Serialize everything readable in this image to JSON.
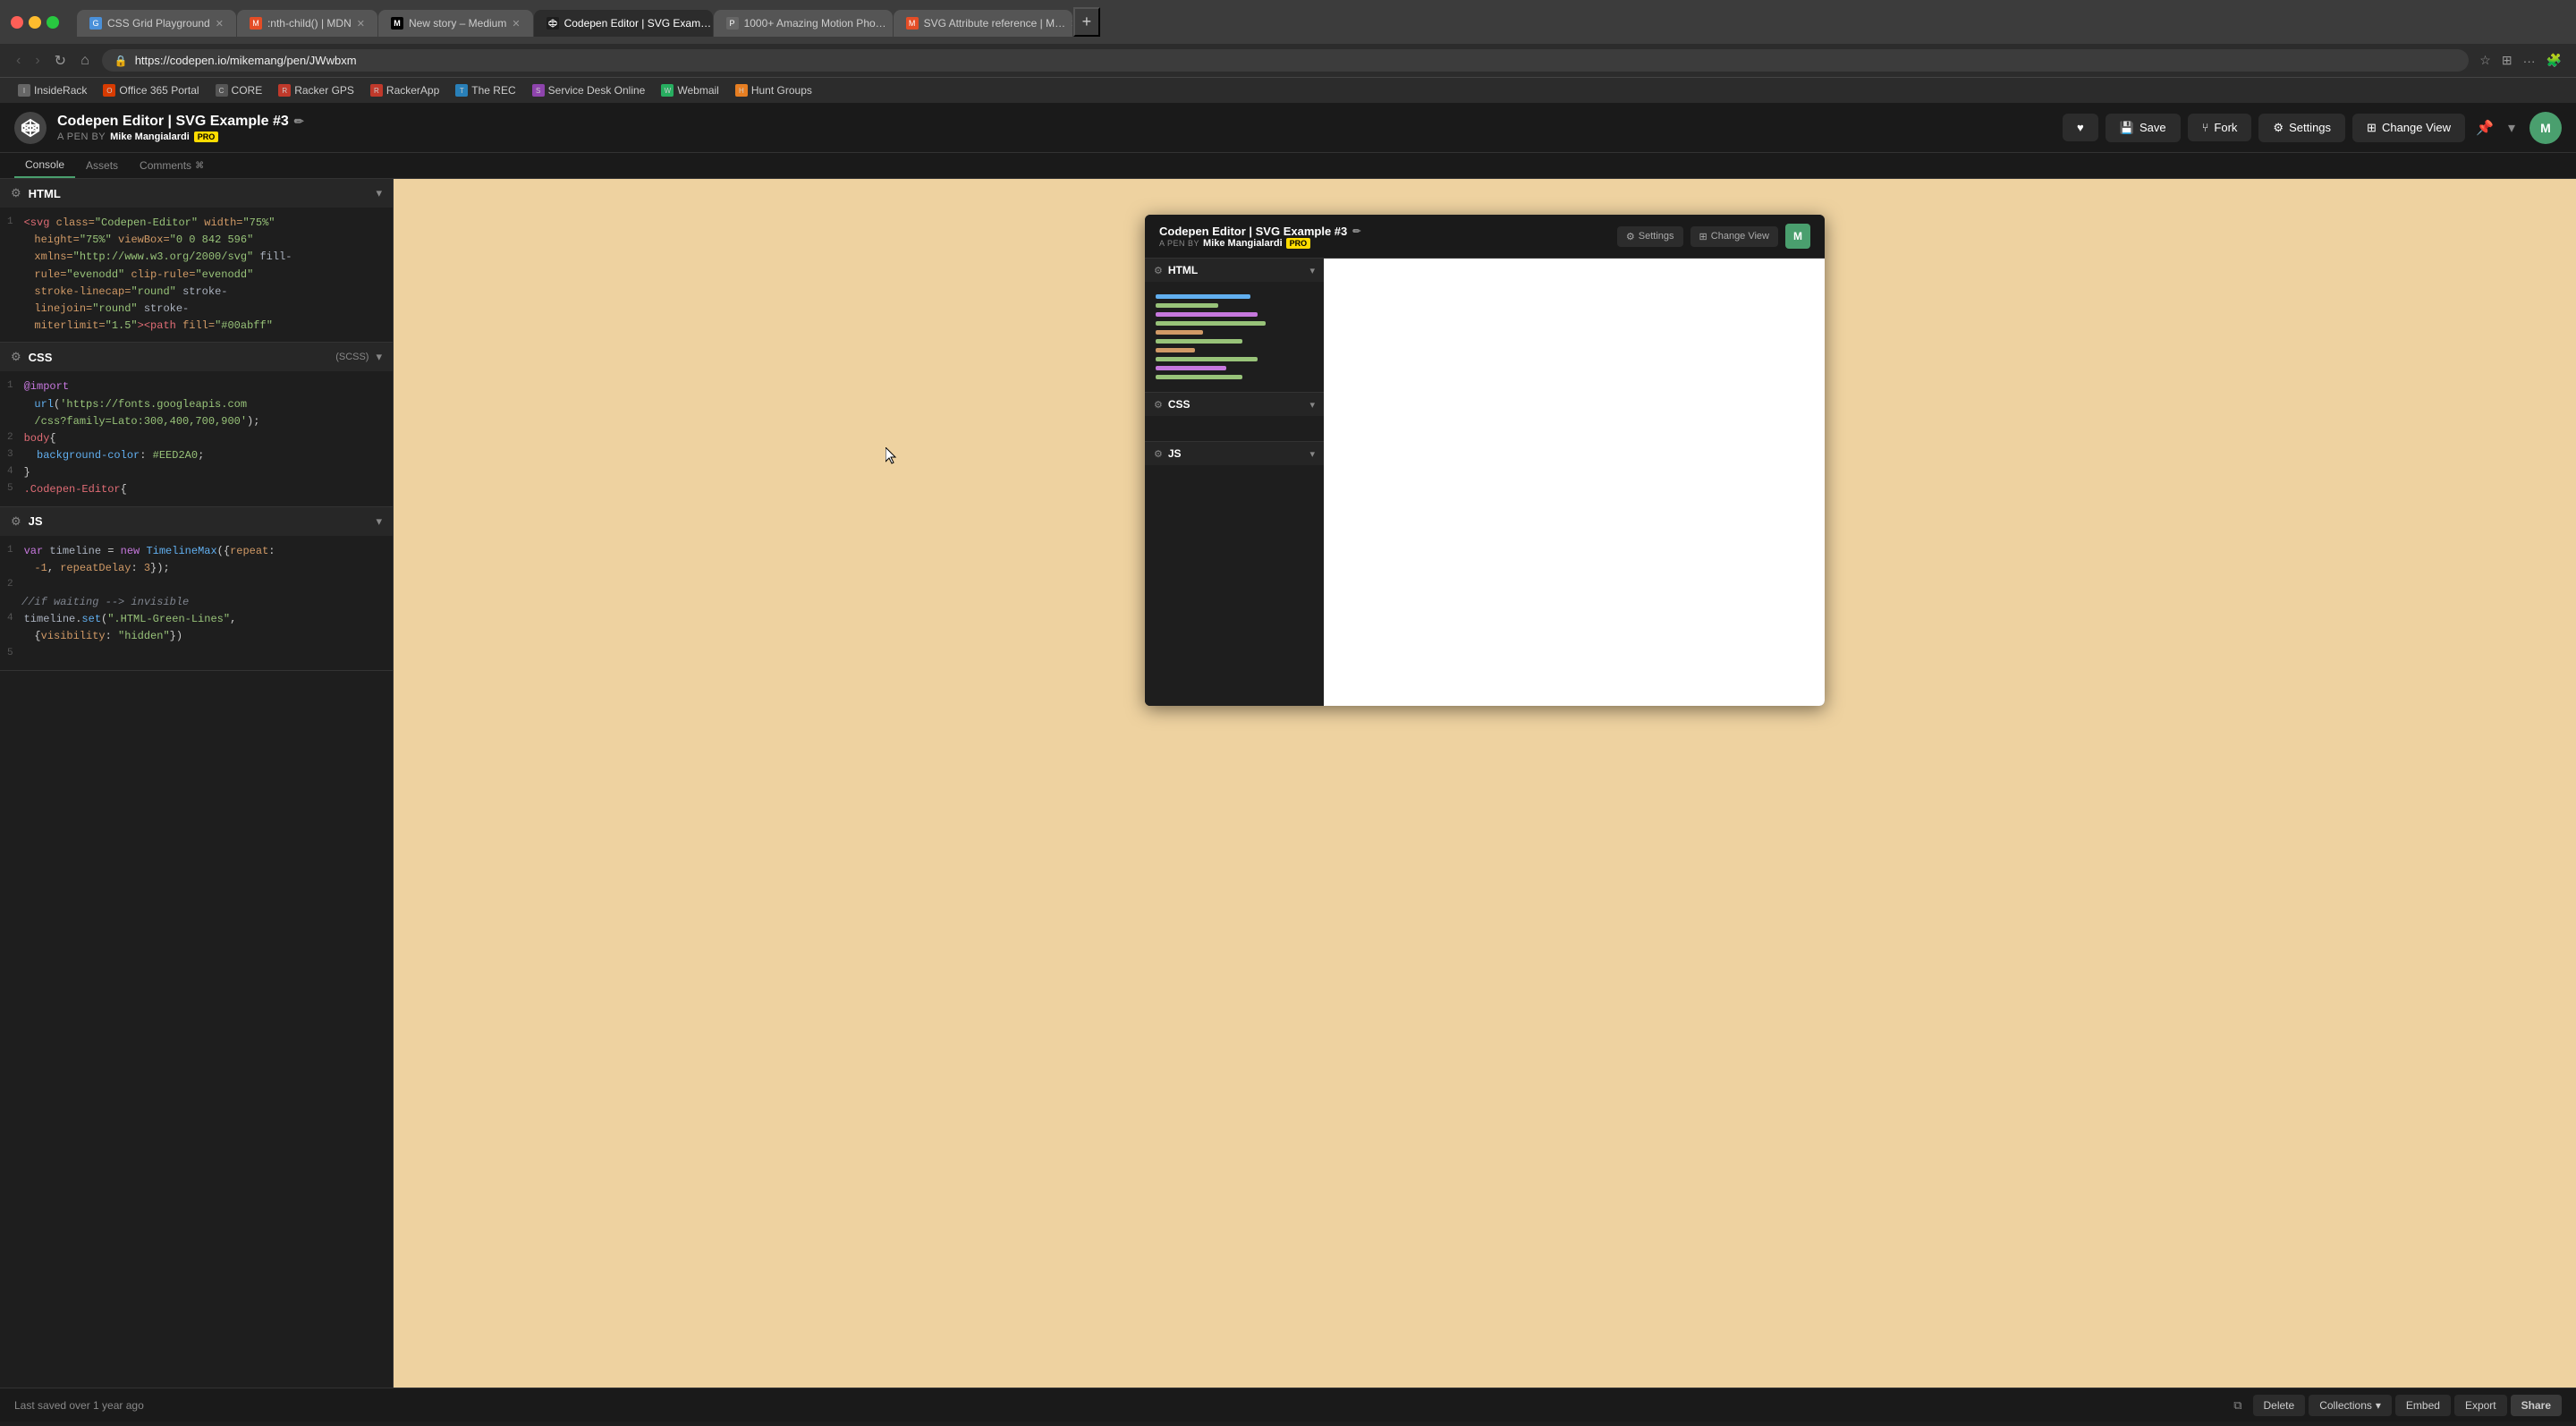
{
  "browser": {
    "tabs": [
      {
        "id": "css-grid",
        "label": "CSS Grid Playground",
        "favicon": "grid",
        "active": false
      },
      {
        "id": "nth-child",
        "label": ":nth-child() | MDN",
        "favicon": "mdn",
        "active": false
      },
      {
        "id": "new-story",
        "label": "New story – Medium",
        "favicon": "medium",
        "active": false
      },
      {
        "id": "codepen",
        "label": "Codepen Editor | SVG Exam…",
        "favicon": "codepen",
        "active": true
      },
      {
        "id": "motion",
        "label": "1000+ Amazing Motion Pho…",
        "favicon": "photo",
        "active": false
      },
      {
        "id": "svg-attr",
        "label": "SVG Attribute reference | M…",
        "favicon": "mdn2",
        "active": false
      }
    ],
    "address": "https://codepen.io/mikemang/pen/JWwbxm",
    "bookmarks": [
      {
        "label": "InsideRack",
        "icon": "I"
      },
      {
        "label": "Office 365 Portal",
        "icon": "O"
      },
      {
        "label": "CORE",
        "icon": "C"
      },
      {
        "label": "Racker GPS",
        "icon": "R"
      },
      {
        "label": "RackerApp",
        "icon": "R"
      },
      {
        "label": "The REC",
        "icon": "T"
      },
      {
        "label": "Service Desk Online",
        "icon": "S"
      },
      {
        "label": "Webmail",
        "icon": "W"
      },
      {
        "label": "Hunt Groups",
        "icon": "H"
      }
    ]
  },
  "codepen": {
    "title": "Codepen Editor | SVG Example #3",
    "edit_icon": "✏",
    "pen_by_label": "A PEN BY",
    "author": "Mike Mangialardi",
    "pro_badge": "PRO",
    "buttons": {
      "heart": "♥",
      "save": "Save",
      "fork": "Fork",
      "settings": "Settings",
      "change_view": "Change View"
    },
    "logo_text": "CP"
  },
  "panels": {
    "html": {
      "title": "HTML",
      "lines": [
        {
          "num": "1",
          "content": "<svg class=\"Codepen-Editor\" width=\"75%\""
        },
        {
          "num": "",
          "content": "  height=\"75%\" viewBox=\"0 0 842 596\""
        },
        {
          "num": "",
          "content": "  xmlns=\"http://www.w3.org/2000/svg\" fill-"
        },
        {
          "num": "",
          "content": "  rule=\"evenodd\" clip-rule=\"evenodd\""
        },
        {
          "num": "",
          "content": "  stroke-linecap=\"round\" stroke-"
        },
        {
          "num": "",
          "content": "  linejoin=\"round\" stroke-"
        },
        {
          "num": "",
          "content": "  miterlimit=\"1.5\"><path fill=\"#00abff\""
        }
      ]
    },
    "css": {
      "title": "CSS",
      "subtitle": "(SCSS)",
      "lines": [
        {
          "num": "1",
          "content": "@import"
        },
        {
          "num": "",
          "content": "  url('https://fonts.googleapis.com"
        },
        {
          "num": "",
          "content": "  /css?family=Lato:300,400,700,900');"
        },
        {
          "num": "2",
          "content": "body{"
        },
        {
          "num": "3",
          "content": "  background-color: #EED2A0;"
        },
        {
          "num": "4",
          "content": "}"
        },
        {
          "num": "5",
          "content": ".Codepen-Editor{"
        }
      ]
    },
    "js": {
      "title": "JS",
      "lines": [
        {
          "num": "1",
          "content": "var timeline = new TimelineMax({repeat:"
        },
        {
          "num": "",
          "content": "  -1, repeatDelay: 3});"
        },
        {
          "num": "2",
          "content": ""
        },
        {
          "num": "",
          "content": "//if waiting --> invisible"
        },
        {
          "num": "4",
          "content": "timeline.set(\".HTML-Green-Lines\","
        },
        {
          "num": "",
          "content": "  {visibility: \"hidden\"})"
        },
        {
          "num": "5",
          "content": ""
        }
      ]
    }
  },
  "embed": {
    "title": "Codepen Editor | SVG Example #3",
    "edit_icon": "✏",
    "pen_by": "A PEN BY",
    "author": "Mike Mangialardi",
    "pro_badge": "PRO",
    "settings_label": "Settings",
    "change_view_label": "Change View",
    "avatar_letter": "M",
    "html_panel": "HTML",
    "css_panel": "CSS",
    "js_panel": "JS",
    "code_bars": {
      "html": [
        {
          "width": "60%",
          "color": "#61afef"
        },
        {
          "width": "40%",
          "color": "#98c379"
        },
        {
          "width": "65%",
          "color": "#c678dd"
        },
        {
          "width": "70%",
          "color": "#98c379"
        },
        {
          "width": "30%",
          "color": "#d19a66"
        },
        {
          "width": "55%",
          "color": "#98c379"
        },
        {
          "width": "25%",
          "color": "#d19a66"
        },
        {
          "width": "65%",
          "color": "#98c379"
        },
        {
          "width": "45%",
          "color": "#c678dd"
        },
        {
          "width": "55%",
          "color": "#98c379"
        }
      ]
    }
  },
  "status_bar": {
    "saved_text": "Last saved over 1 year ago",
    "delete_label": "Delete",
    "collections_label": "Collections",
    "embed_label": "Embed",
    "export_label": "Export",
    "share_label": "Share",
    "console_label": "Console",
    "assets_label": "Assets",
    "comments_label": "Comments"
  }
}
